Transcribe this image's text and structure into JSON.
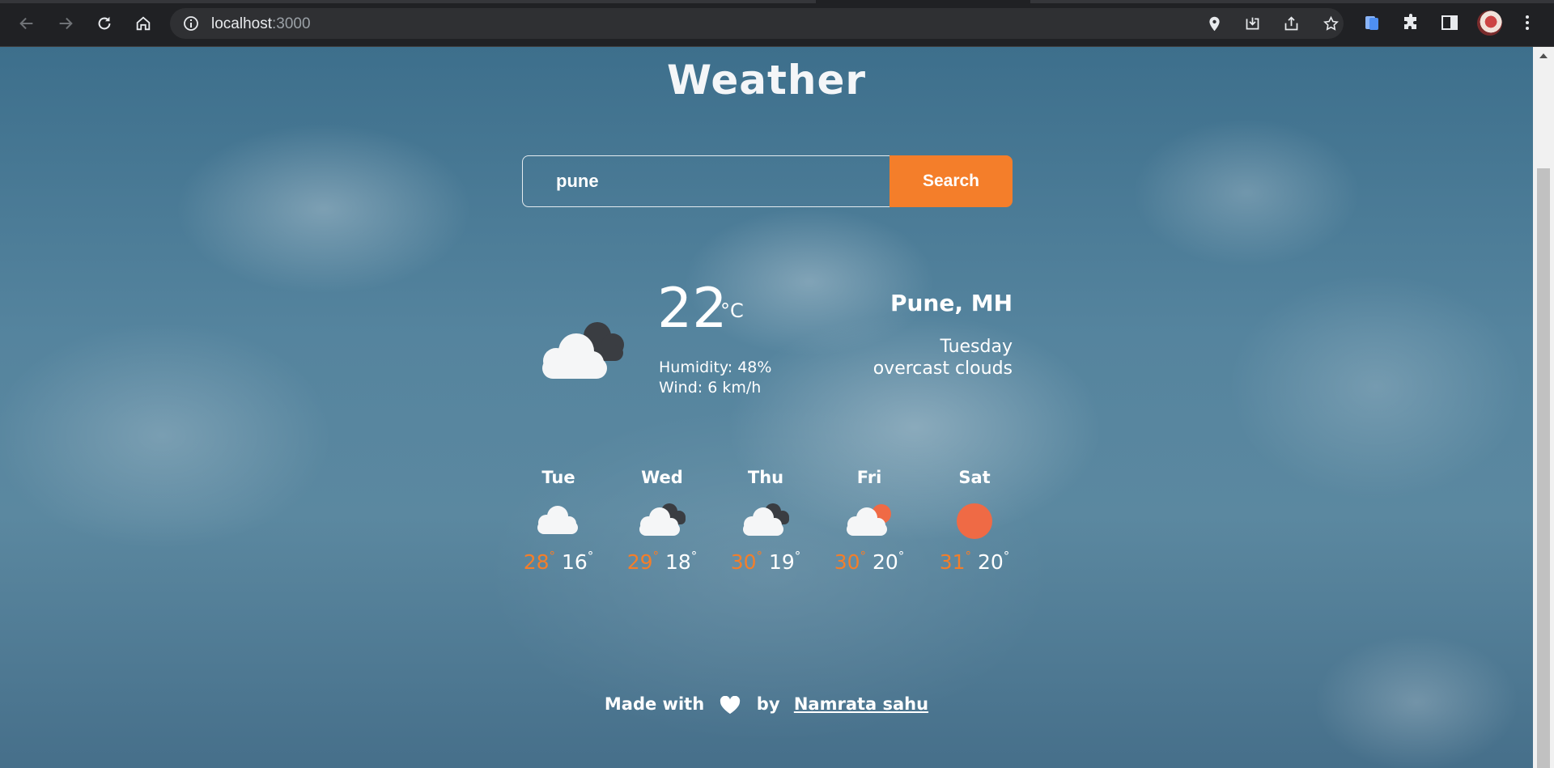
{
  "browser": {
    "url_host": "localhost",
    "url_port": ":3000",
    "icons": [
      "back-icon",
      "forward-icon",
      "reload-icon",
      "home-icon",
      "site-info-icon",
      "location-icon",
      "install-icon",
      "share-icon",
      "bookmark-star-icon",
      "extension-icon",
      "puzzle-icon",
      "side-panel-icon",
      "profile-avatar",
      "menu-icon"
    ]
  },
  "app": {
    "title": "Weather",
    "search": {
      "value": "pune",
      "button_label": "Search"
    },
    "current": {
      "temp": "22",
      "unit": "°C",
      "humidity": "Humidity: 48%",
      "wind": "Wind: 6 km/h",
      "location": "Pune, MH",
      "day": "Tuesday",
      "description": "overcast clouds",
      "icon": "broken-clouds-icon"
    },
    "forecast": [
      {
        "day": "Tue",
        "icon": "cloud-icon",
        "high": "28",
        "low": "16"
      },
      {
        "day": "Wed",
        "icon": "broken-clouds-icon",
        "high": "29",
        "low": "18"
      },
      {
        "day": "Thu",
        "icon": "broken-clouds-icon",
        "high": "30",
        "low": "19"
      },
      {
        "day": "Fri",
        "icon": "partly-cloudy-icon",
        "high": "30",
        "low": "20"
      },
      {
        "day": "Sat",
        "icon": "sun-icon",
        "high": "31",
        "low": "20"
      }
    ],
    "degree_symbol": "°",
    "footer": {
      "made_with": "Made with",
      "by": "by",
      "author": "Namrata sahu"
    }
  },
  "colors": {
    "accent": "#f47e2a",
    "sun": "#ef6a45",
    "chrome": "#202124"
  }
}
